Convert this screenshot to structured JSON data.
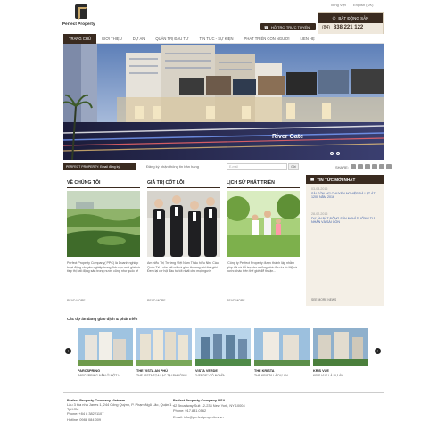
{
  "header": {
    "logo_text": "Perfect Property",
    "lang_vi": "Tiếng Việt",
    "lang_en": "English (UK)",
    "support_label": "HỖ TRỢ TRỰC TUYẾN",
    "contact_title": "BẤT ĐỘNG SẢN",
    "phone_prefix": "(84)",
    "phone": "838 221 122",
    "search_placeholder": "Tìm kiếm..."
  },
  "nav": {
    "items": [
      "TRANG CHỦ",
      "GIỚI THIỆU",
      "DỰ ÁN",
      "QUẢN TRỊ ĐẦU TƯ",
      "TIN TỨC - SỰ KIỆN",
      "PHÁT TRIỂN CON NGƯỜI",
      "LIÊN HỆ"
    ]
  },
  "banner": {
    "caption": "River Gate"
  },
  "newsletter": {
    "bar_label": "PERFECT PROPERTY: Email đăng ký",
    "label": "Đăng ký nhận thông tin bản hàng",
    "email_placeholder": "E-mail",
    "send": "Gửi"
  },
  "share": {
    "label": "SHARE:"
  },
  "columns": [
    {
      "title": "VỀ CHÚNG TÔI",
      "text": "Perfect Property Company( PPC) là Doanh nghiệp hoạt động chuyên nghiệp trong lĩnh vực môi giới và tiếp thị bất động sản trong nước cũng như quốc tế",
      "more": "READ MORE"
    },
    {
      "title": "GIÁ TRỊ CỐT LÕI",
      "text": "Am hiểu Thị Trường Việt Nam Thấu hiểu Nhu Cầu Quốc Tế Luôn kết nối và giao thương với thế giới Đem lại cơ hội đầu tư tốt nhất cho mọi người",
      "more": "READ MORE"
    },
    {
      "title": "LỊCH SỬ PHÁT TRIỂN",
      "text": "\"Công ty Perfect Property được thành lập nhằm giúp đỡ và hỗ trợ cho những nhà đầu tư từ Mỹ và nước khác trên thế giới để thuận...",
      "more": "READ MORE"
    }
  ],
  "sidebar": {
    "title": "TIN TỨC MỚI NHẤT",
    "items": [
      {
        "date": "03-03-2016",
        "title": "SÀI GÒN NỢ CHUYỂN NGHIỆP ĐÀ LẠT ÁT 1200 NĂM 2016"
      },
      {
        "date": "28-02-2016",
        "title": "DỰ ÁN BẤT ĐỘNG SẢN NGHỈ DƯỠNG TƯ NHÂN VÀ SÀI GÒN"
      }
    ],
    "more": "SEE MORE NEWS"
  },
  "projects": {
    "title": "Các dự án đang giao dịch & phát triển",
    "items": [
      {
        "name": "PARCSPRING",
        "sub": "PARCSPRING NĂM Ở MỘT V..."
      },
      {
        "name": "THE VISTA AN PHÚ",
        "sub": "THE VISTA TỌA LẠC TẠI PHƯỜNG..."
      },
      {
        "name": "VISTA VERDE",
        "sub": "\"VERDE\" CÓ NGHĨA..."
      },
      {
        "name": "THE KRISTA",
        "sub": "THE KRISTA LÀ DỰ ÁN..."
      },
      {
        "name": "KRIS VUE",
        "sub": "KRIS VUE LÀ DỰ ÁN..."
      }
    ]
  },
  "footer": {
    "vn": {
      "company": "Perfect Property Company Vietnam",
      "address": "Lầu 3 tòa nhà Janes 1, 244 Cống Quỳnh, P. Phạm Ngũ Lão, Quận 1 - TpHCM",
      "phone": "Phone: +84 8 38221107",
      "hotline": "Hotline: 0988 084 009"
    },
    "usa": {
      "company": "Perfect Property Company USA",
      "address": "42 Broadway Suit 12-233 New York, NY 10004",
      "phone": "Phone: 917.831.0562",
      "email": "Email: info@perfectproperties.vn"
    }
  },
  "colors": {
    "brand": "#3a2b20",
    "cream": "#efe8dc",
    "link": "#3b5ea8"
  }
}
